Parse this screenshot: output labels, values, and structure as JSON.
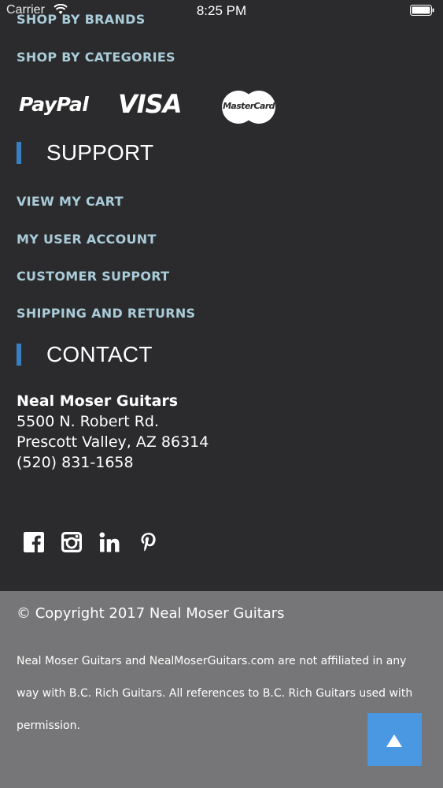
{
  "status_bar": {
    "carrier": "Carrier",
    "time": "8:25 PM"
  },
  "footer_links": {
    "shop_by_brands": "SHOP BY BRANDS",
    "shop_by_categories": "SHOP BY CATEGORIES"
  },
  "payments": {
    "paypal": "PayPal",
    "visa": "VISA",
    "mastercard": "MasterCard"
  },
  "support": {
    "heading": "SUPPORT",
    "items": [
      {
        "label": "VIEW MY CART"
      },
      {
        "label": "MY USER ACCOUNT"
      },
      {
        "label": "CUSTOMER SUPPORT"
      },
      {
        "label": "SHIPPING AND RETURNS"
      }
    ]
  },
  "contact": {
    "heading": "CONTACT",
    "name": "Neal Moser Guitars",
    "address_line1": "5500 N. Robert Rd.",
    "address_line2": "Prescott Valley, AZ 86314",
    "phone": "(520) 831-1658"
  },
  "social": {
    "icons": [
      "facebook-icon",
      "instagram-icon",
      "linkedin-icon",
      "pinterest-icon"
    ]
  },
  "copyright": {
    "text": "© Copyright 2017 Neal Moser Guitars",
    "disclaimer": "Neal Moser Guitars and NealMoserGuitars.com are not affiliated in any way with B.C. Rich Guitars.  All references to B.C. Rich Guitars used with permission."
  },
  "colors": {
    "background": "#2b2b2d",
    "link": "#a9ccd8",
    "heading_accent": "#3a7fc1",
    "footer_gray": "#767577",
    "scroll_button": "#4a98e2"
  }
}
